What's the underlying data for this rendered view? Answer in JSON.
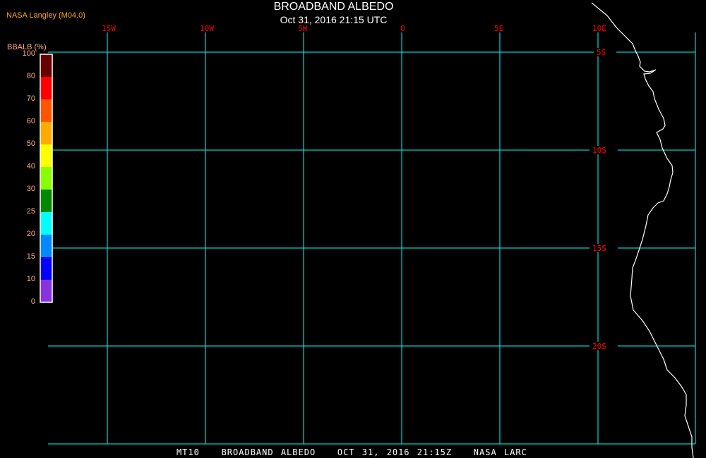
{
  "header": {
    "producer": "NASA Langley (M04.0)",
    "title": "BROADBAND ALBEDO",
    "subtitle": "Oct 31, 2016 21:15 UTC"
  },
  "footer": "MT10   BROADBAND ALBEDO   OCT 31, 2016 21:15Z   NASA LARC",
  "map": {
    "longitude_labels": [
      "15W",
      "10W",
      "5W",
      "0",
      "5E",
      "10E"
    ],
    "latitude_labels": [
      "5S",
      "10S",
      "15S",
      "20S"
    ],
    "grid_color": "#00ffff",
    "label_color": "#ff0000",
    "coast_color": "#ffffff"
  },
  "colorbar": {
    "title": "BBALB (%)",
    "labels": [
      "100",
      "80",
      "70",
      "60",
      "50",
      "40",
      "30",
      "25",
      "20",
      "15",
      "10",
      "0"
    ],
    "colors": [
      "#660000",
      "#ff0000",
      "#ff5500",
      "#ffaa00",
      "#ffff00",
      "#88ff00",
      "#008800",
      "#00ffff",
      "#0088ff",
      "#0000ff",
      "#8833dd"
    ]
  }
}
